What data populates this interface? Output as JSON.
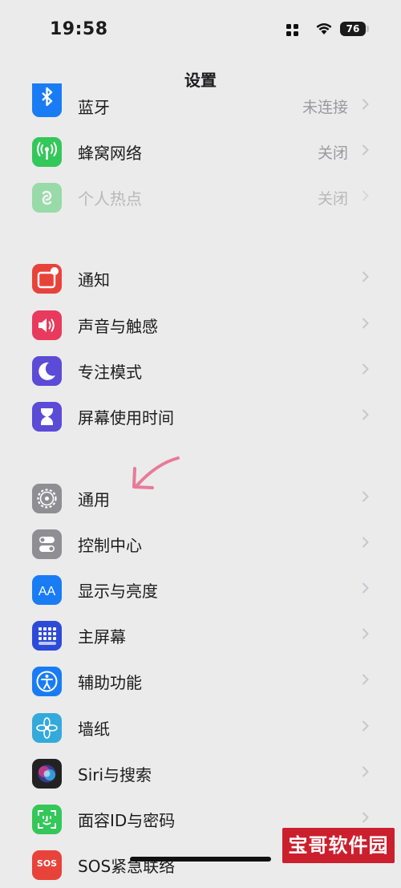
{
  "status_bar": {
    "time": "19:58",
    "battery": "76"
  },
  "page_title": "设置",
  "groups": [
    {
      "items": [
        {
          "label": "蓝牙",
          "value": "未连接",
          "icon": "bluetooth-icon",
          "color": "#1a7cf5"
        },
        {
          "label": "蜂窝网络",
          "value": "关闭",
          "icon": "cellular-antenna-icon",
          "color": "#34c759"
        },
        {
          "label": "个人热点",
          "value": "关闭",
          "icon": "personal-hotspot-icon",
          "color": "#8fe0c0"
        }
      ]
    },
    {
      "items": [
        {
          "label": "通知",
          "value": "",
          "icon": "notifications-icon",
          "color": "#e8433b"
        },
        {
          "label": "声音与触感",
          "value": "",
          "icon": "speaker-icon",
          "color": "#e83a5d"
        },
        {
          "label": "专注模式",
          "value": "",
          "icon": "moon-icon",
          "color": "#5b4bd6"
        },
        {
          "label": "屏幕使用时间",
          "value": "",
          "icon": "hourglass-icon",
          "color": "#5b4bd6"
        }
      ]
    },
    {
      "items": [
        {
          "label": "通用",
          "value": "",
          "icon": "gear-icon",
          "color": "#8e8e93"
        },
        {
          "label": "控制中心",
          "value": "",
          "icon": "toggles-icon",
          "color": "#8e8e93"
        },
        {
          "label": "显示与亮度",
          "value": "",
          "icon": "text-size-icon",
          "color": "#1a7cf5"
        },
        {
          "label": "主屏幕",
          "value": "",
          "icon": "home-screen-grid-icon",
          "color": "#2c4bd8"
        },
        {
          "label": "辅助功能",
          "value": "",
          "icon": "accessibility-icon",
          "color": "#1a7cf5"
        },
        {
          "label": "墙纸",
          "value": "",
          "icon": "wallpaper-flower-icon",
          "color": "#34aadc"
        },
        {
          "label": "Siri与搜索",
          "value": "",
          "icon": "siri-icon",
          "color": "#222222"
        },
        {
          "label": "面容ID与密码",
          "value": "",
          "icon": "face-id-icon",
          "color": "#34c759"
        },
        {
          "label": "SOS紧急联络",
          "value": "",
          "icon": "sos-icon",
          "color": "#e8433b",
          "icon_text": "SOS"
        }
      ]
    }
  ],
  "watermark": "宝哥软件园"
}
